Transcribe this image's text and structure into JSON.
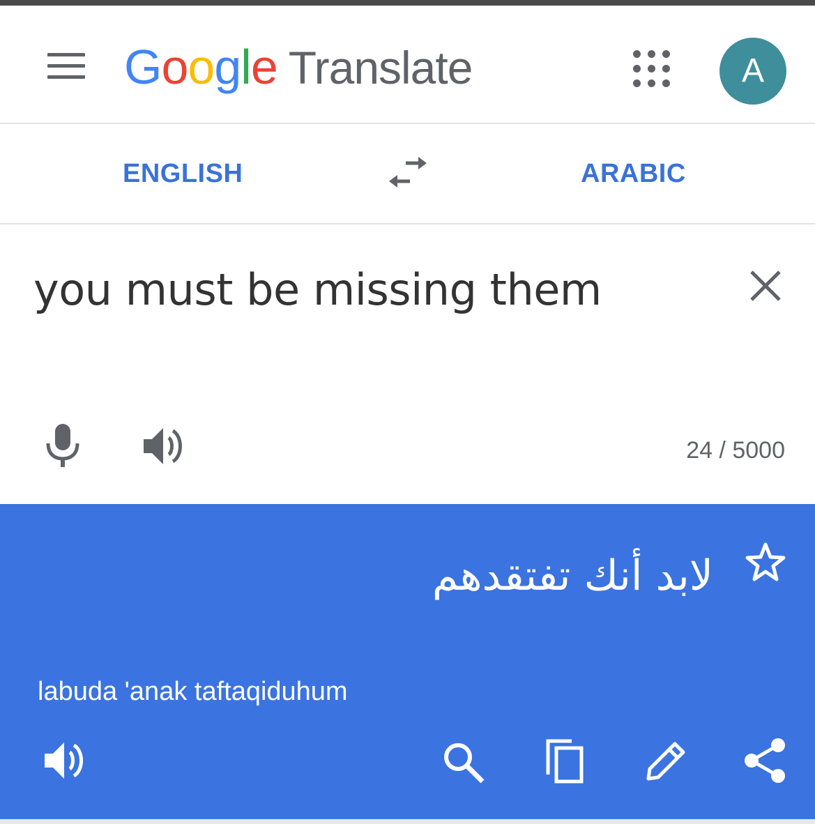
{
  "header": {
    "logo_letters": [
      {
        "char": "G",
        "color": "#4285f4"
      },
      {
        "char": "o",
        "color": "#ea4335"
      },
      {
        "char": "o",
        "color": "#fbbc05"
      },
      {
        "char": "g",
        "color": "#4285f4"
      },
      {
        "char": "l",
        "color": "#34a853"
      },
      {
        "char": "e",
        "color": "#ea4335"
      }
    ],
    "product_name": "Translate",
    "avatar_initial": "A",
    "avatar_color": "#3f8e9c",
    "menu_icon": "hamburger-menu-icon",
    "apps_icon": "apps-grid-icon"
  },
  "languages": {
    "source": "ENGLISH",
    "target": "ARABIC",
    "swap_icon": "swap-arrows-icon",
    "accent_color": "#3a72d8"
  },
  "input": {
    "text": "you must be missing them",
    "char_count": "24 / 5000",
    "icons": [
      "close-icon",
      "microphone-icon",
      "speaker-icon"
    ]
  },
  "result": {
    "translated_text": "لابد أنك تفتقدهم",
    "transliteration": "labuda 'anak taftaqiduhum",
    "background_color": "#3b73e0",
    "icons": [
      "star-icon",
      "speaker-icon",
      "search-icon",
      "copy-icon",
      "edit-icon",
      "share-icon"
    ]
  }
}
